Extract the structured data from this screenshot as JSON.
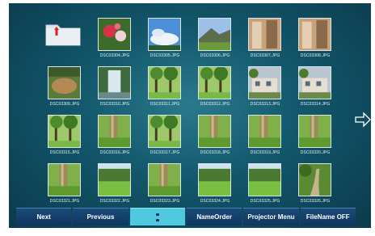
{
  "files": [
    {
      "name": "DSC03304.JPG",
      "scene": "flower"
    },
    {
      "name": "DSC03305.JPG",
      "scene": "sky"
    },
    {
      "name": "DSC03306.JPG",
      "scene": "mountain"
    },
    {
      "name": "DSC03307.JPG",
      "scene": "door"
    },
    {
      "name": "DSC03308.JPG",
      "scene": "door"
    },
    {
      "name": "DSC03309.JPG",
      "scene": "rock"
    },
    {
      "name": "DSC03310.JPG",
      "scene": "waterfall"
    },
    {
      "name": "DSC03311.JPG",
      "scene": "trees"
    },
    {
      "name": "DSC03312.JPG",
      "scene": "trees"
    },
    {
      "name": "DSC03313.JPG",
      "scene": "building"
    },
    {
      "name": "DSC03314.JPG",
      "scene": "building"
    },
    {
      "name": "DSC03315.JPG",
      "scene": "trees"
    },
    {
      "name": "DSC03316.JPG",
      "scene": "trunk"
    },
    {
      "name": "DSC03317.JPG",
      "scene": "trees"
    },
    {
      "name": "DSC03318.JPG",
      "scene": "trunk"
    },
    {
      "name": "DSC03319.JPG",
      "scene": "trunk"
    },
    {
      "name": "DSC03320.JPG",
      "scene": "trunk"
    },
    {
      "name": "DSC03321.JPG",
      "scene": "trunk"
    },
    {
      "name": "DSC03322.JPG",
      "scene": "lawn"
    },
    {
      "name": "DSC03323.JPG",
      "scene": "trunk"
    },
    {
      "name": "DSC03324.JPG",
      "scene": "lawn"
    },
    {
      "name": "DSC03325.JPG",
      "scene": "lawn"
    },
    {
      "name": "DSC03326.JPG",
      "scene": "path"
    }
  ],
  "folder": {
    "icon": "folder-up-icon"
  },
  "next_page_icon": "arrow-right-icon",
  "toolbar": {
    "next": "Next",
    "previous": "Previous",
    "name_order": "NameOrder",
    "projector_menu": "Projector Menu",
    "filename_toggle": "FileName OFF"
  },
  "colors": {
    "accent": "#4fc8e0",
    "button": "#12406c",
    "background": "#12566a"
  }
}
